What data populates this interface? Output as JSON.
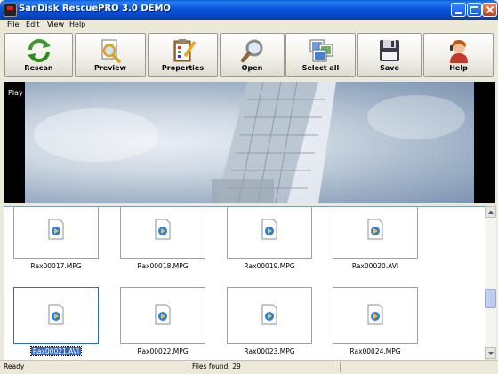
{
  "window": {
    "title": "SanDisk RescuePRO 3.0 DEMO"
  },
  "menu": [
    "File",
    "Edit",
    "View",
    "Help"
  ],
  "toolbar": [
    {
      "label": "Rescan",
      "icon": "rescan-arrows-icon"
    },
    {
      "label": "Preview",
      "icon": "magnifier-document-icon"
    },
    {
      "label": "Properties",
      "icon": "clipboard-pencil-icon"
    },
    {
      "label": "Open",
      "icon": "magnifier-icon"
    },
    {
      "label": "Select all",
      "icon": "pictures-stack-icon"
    },
    {
      "label": "Save",
      "icon": "floppy-disk-icon"
    },
    {
      "label": "Help",
      "icon": "help-person-icon"
    }
  ],
  "preview": {
    "label": "Play"
  },
  "files": [
    {
      "name": "Rax00017.MPG"
    },
    {
      "name": "Rax00018.MPG"
    },
    {
      "name": "Rax00019.MPG"
    },
    {
      "name": "Rax00020.AVI"
    },
    {
      "name": "Rax00021.AVI",
      "selected": true
    },
    {
      "name": "Rax00022.MPG"
    },
    {
      "name": "Rax00023.MPG"
    },
    {
      "name": "Rax00024.MPG"
    }
  ],
  "status": {
    "left": "Ready",
    "files_found": "Files found: 29"
  },
  "colors": {
    "title_bar": "#0a5fd8",
    "selection": "#316ac5",
    "window_bg": "#ece9d8"
  }
}
